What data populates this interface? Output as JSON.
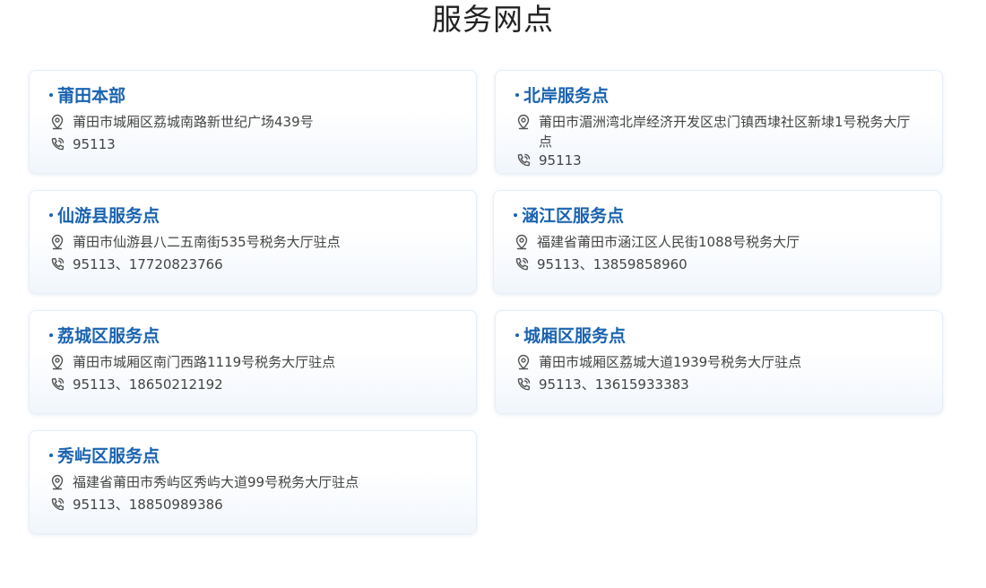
{
  "page": {
    "title": "服务网点"
  },
  "icons": {
    "address": "location-pin-icon",
    "phone": "phone-icon"
  },
  "colors": {
    "title_accent": "#1a63b0",
    "card_border": "#e6eef7"
  },
  "service_points": [
    {
      "name": "莆田本部",
      "address": "莆田市城厢区荔城南路新世纪广场439号",
      "phone": "95113"
    },
    {
      "name": "北岸服务点",
      "address": "莆田市湄洲湾北岸经济开发区忠门镇西埭社区新埭1号税务大厅点",
      "phone": "95113"
    },
    {
      "name": "仙游县服务点",
      "address": "莆田市仙游县八二五南街535号税务大厅驻点",
      "phone": "95113、17720823766"
    },
    {
      "name": "涵江区服务点",
      "address": "福建省莆田市涵江区人民街1088号税务大厅",
      "phone": "95113、13859858960"
    },
    {
      "name": "荔城区服务点",
      "address": "莆田市城厢区南门西路1119号税务大厅驻点",
      "phone": "95113、18650212192"
    },
    {
      "name": "城厢区服务点",
      "address": "莆田市城厢区荔城大道1939号税务大厅驻点",
      "phone": "95113、13615933383"
    },
    {
      "name": "秀屿区服务点",
      "address": "福建省莆田市秀屿区秀屿大道99号税务大厅驻点",
      "phone": "95113、18850989386"
    }
  ]
}
